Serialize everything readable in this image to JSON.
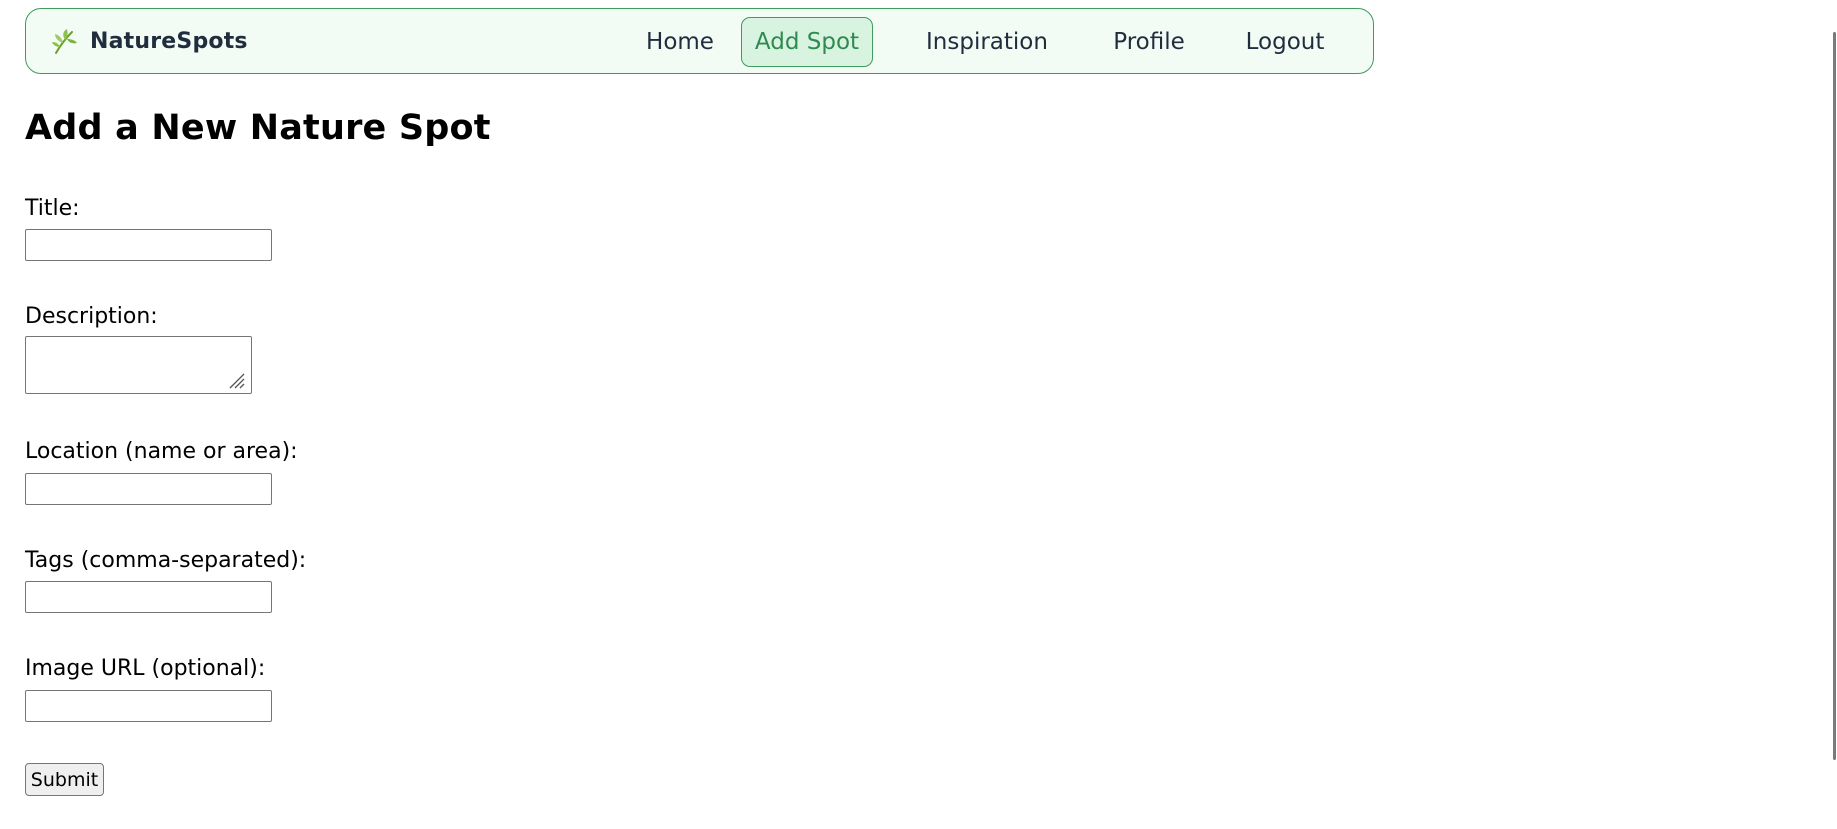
{
  "brand": {
    "name": "NatureSpots",
    "icon": "leaf-icon",
    "icon_color": "#8bc34a"
  },
  "nav": {
    "items": [
      {
        "label": "Home",
        "active": false
      },
      {
        "label": "Add Spot",
        "active": true
      },
      {
        "label": "Inspiration",
        "active": false
      },
      {
        "label": "Profile",
        "active": false
      },
      {
        "label": "Logout",
        "active": false
      }
    ],
    "accent_color": "#2e8b50",
    "active_background": "#d9f3e1",
    "bar_background": "#f3fbf5"
  },
  "page": {
    "title": "Add a New Nature Spot"
  },
  "form": {
    "title_label": "Title:",
    "title_value": "",
    "description_label": "Description:",
    "description_value": "",
    "location_label": "Location (name or area):",
    "location_value": "",
    "tags_label": "Tags (comma-separated):",
    "tags_value": "",
    "image_url_label": "Image URL (optional):",
    "image_url_value": "",
    "submit_label": "Submit"
  }
}
